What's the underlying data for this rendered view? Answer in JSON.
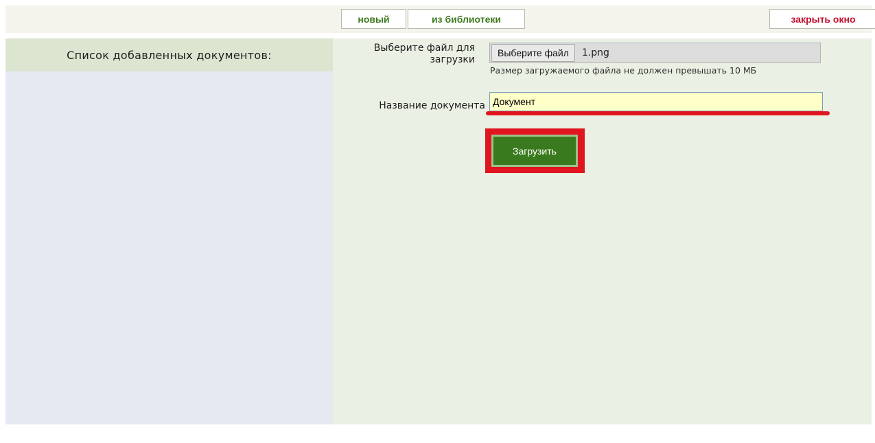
{
  "header": {
    "tab_new": "новый",
    "tab_library": "из библиотеки",
    "close_window": "закрыть окно"
  },
  "sidebar": {
    "title": "Список добавленных документов:"
  },
  "form": {
    "file_label": "Выберите файл для загрузки",
    "file_button": "Выберите файл",
    "file_name": "1.png",
    "file_hint": "Размер загружаемого файла не должен превышать 10 МБ",
    "name_label": "Название документа",
    "name_value": "Документ",
    "submit": "Загрузить"
  },
  "colors": {
    "accent_green": "#3a7a1e",
    "close_red": "#c0112f",
    "highlight_red": "#e0151f",
    "input_bg": "#ffffc8"
  }
}
